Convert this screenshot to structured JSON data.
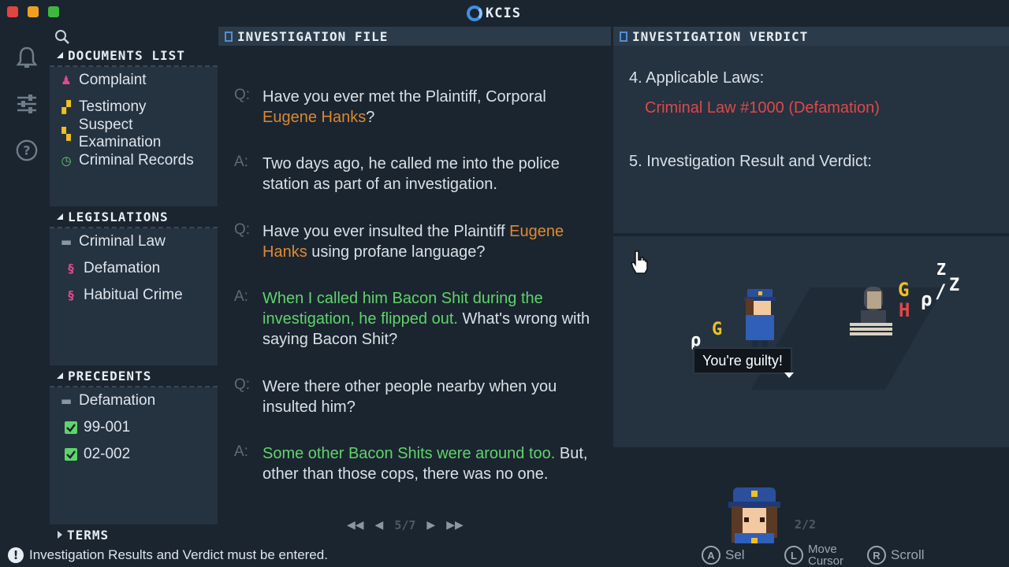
{
  "app": {
    "title": "KCIS"
  },
  "sidebar": {
    "documents_header": "DOCUMENTS LIST",
    "documents": [
      {
        "label": "Complaint",
        "icon": "complaint-icon",
        "color": "#e04a8f"
      },
      {
        "label": "Testimony",
        "icon": "testimony-icon",
        "color": "#f0c020"
      },
      {
        "label": "Suspect Examination",
        "icon": "examination-icon",
        "color": "#f0c020"
      },
      {
        "label": "Criminal Records",
        "icon": "records-icon",
        "color": "#5fd46a"
      }
    ],
    "legislations_header": "LEGISLATIONS",
    "legislations": [
      {
        "label": "Criminal Law",
        "icon": "folder-icon"
      },
      {
        "label": "Defamation",
        "icon": "law-icon"
      },
      {
        "label": "Habitual Crime",
        "icon": "law-icon"
      }
    ],
    "precedents_header": "PRECEDENTS",
    "precedents": [
      {
        "label": "Defamation",
        "icon": "folder-icon"
      },
      {
        "label": "99-001",
        "icon": "check-icon"
      },
      {
        "label": "02-002",
        "icon": "check-icon"
      }
    ],
    "terms_header": "TERMS"
  },
  "investigation_file": {
    "header": "INVESTIGATION FILE",
    "q_tag": "Q:",
    "a_tag": "A:",
    "entries": [
      {
        "pre": "Have you ever met the Plaintiff, Corporal ",
        "hl": "Eugene Hanks",
        "post": "?"
      },
      {
        "text": "Two days ago, he called me into the police station as part of an investigation."
      },
      {
        "pre": "Have you ever insulted the Plaintiff ",
        "hl": "Eugene Hanks",
        "post": " using profane language?"
      },
      {
        "hl": "When I called him Bacon Shit during the investigation, he flipped out.",
        "post": " What's wrong with saying Bacon Shit?"
      },
      {
        "text": "Were there other people nearby when you insulted him?"
      },
      {
        "hl": "Some other Bacon Shits were around too.",
        "post": " But, other than those cops, there was no one."
      }
    ],
    "page": "5/7"
  },
  "verdict": {
    "header": "INVESTIGATION VERDICT",
    "laws_label": "4. Applicable Laws:",
    "law": "Criminal Law #1000 (Defamation)",
    "result_label": "5. Investigation Result and Verdict:"
  },
  "scene": {
    "speech": "You're guilty!",
    "page": "2/2"
  },
  "status": {
    "message": "Investigation Results and Verdict must be entered.",
    "hints": [
      {
        "button": "A",
        "label": "Sel"
      },
      {
        "button": "L",
        "label": "Move Cursor"
      },
      {
        "button": "R",
        "label": "Scroll"
      }
    ]
  },
  "colors": {
    "accent_blue": "#3f8fe0",
    "highlight_orange": "#e08a2e",
    "highlight_green": "#5fd46a",
    "law_red": "#e04848"
  }
}
